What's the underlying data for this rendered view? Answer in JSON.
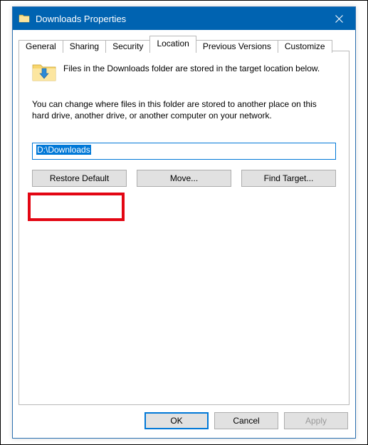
{
  "window": {
    "title": "Downloads Properties"
  },
  "tabs": {
    "general": "General",
    "sharing": "Sharing",
    "security": "Security",
    "location": "Location",
    "previous": "Previous Versions",
    "customize": "Customize"
  },
  "location": {
    "intro": "Files in the Downloads folder are stored in the target location below.",
    "desc": "You can change where files in this folder are stored to another place on this hard drive, another drive, or another computer on your network.",
    "path": "D:\\Downloads",
    "restore_default": "Restore Default",
    "move": "Move...",
    "find_target": "Find Target..."
  },
  "footer": {
    "ok": "OK",
    "cancel": "Cancel",
    "apply": "Apply"
  }
}
